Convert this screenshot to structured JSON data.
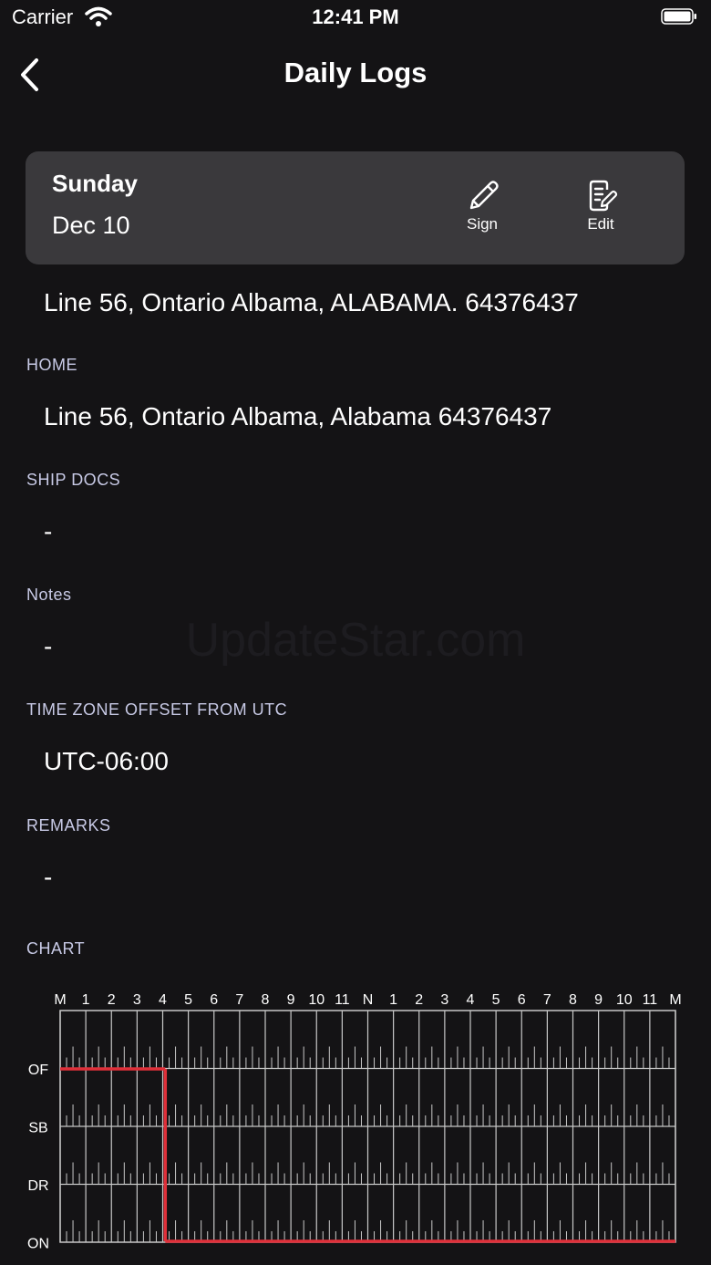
{
  "status_bar": {
    "carrier": "Carrier",
    "time": "12:41 PM"
  },
  "nav": {
    "title": "Daily Logs"
  },
  "day_card": {
    "day_name": "Sunday",
    "date": "Dec 10",
    "sign_label": "Sign",
    "edit_label": "Edit"
  },
  "partial_address": "Line 56, Ontario Albama, ALABAMA. 64376437",
  "sections": [
    {
      "label": "HOME",
      "value": "Line 56, Ontario Albama, Alabama 64376437"
    },
    {
      "label": "SHIP DOCS",
      "value": "-"
    },
    {
      "label": "Notes",
      "value": "-"
    },
    {
      "label": "TIME ZONE OFFSET FROM UTC",
      "value": "UTC-06:00"
    },
    {
      "label": "REMARKS",
      "value": "-"
    },
    {
      "label": "CHART",
      "value": ""
    }
  ],
  "watermark": "UpdateStar.com",
  "chart_data": {
    "type": "line",
    "hour_labels": [
      "M",
      "1",
      "2",
      "3",
      "4",
      "5",
      "6",
      "7",
      "8",
      "9",
      "10",
      "11",
      "N",
      "1",
      "2",
      "3",
      "4",
      "5",
      "6",
      "7",
      "8",
      "9",
      "10",
      "11",
      "M"
    ],
    "row_labels": [
      "OF",
      "SB",
      "DR",
      "ON"
    ],
    "xlim": [
      0,
      24
    ],
    "segments": [
      {
        "status": "OF",
        "start": 0,
        "end": 4.1
      },
      {
        "status": "ON",
        "start": 4.1,
        "end": 24
      }
    ],
    "line_color": "#e0303a",
    "grid_color": "#c8c8c8"
  }
}
